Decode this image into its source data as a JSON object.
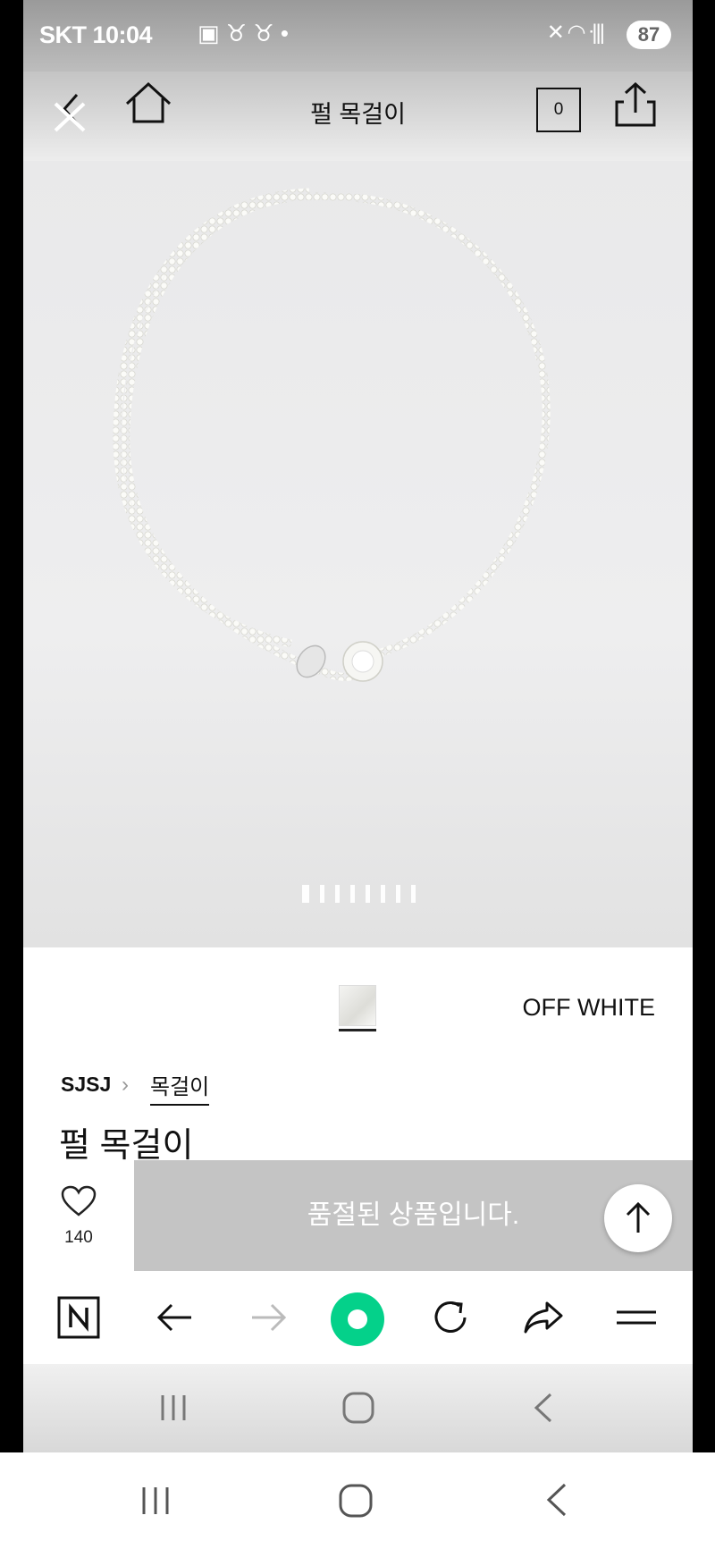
{
  "status_bar": {
    "carrier": "SKT",
    "time": "10:04",
    "battery": "87"
  },
  "header": {
    "title": "펄 목걸이",
    "cart_count": "0",
    "icons": [
      "back-icon",
      "close-icon",
      "home-icon",
      "cart-icon",
      "share-icon"
    ]
  },
  "gallery": {
    "image_count": 8,
    "active_index": 0
  },
  "product": {
    "color_name": "OFF WHITE",
    "brand": "SJSJ",
    "category": "목걸이",
    "name": "펄 목걸이"
  },
  "actions": {
    "like_count": "140",
    "soldout_label": "품절된 상품입니다."
  },
  "browser_toolbar": {
    "icons": [
      "naver-icon",
      "back-arrow-icon",
      "forward-arrow-icon",
      "green-home-icon",
      "refresh-icon",
      "share-arrow-icon",
      "menu-icon"
    ],
    "accent_color": "#04d18a"
  }
}
